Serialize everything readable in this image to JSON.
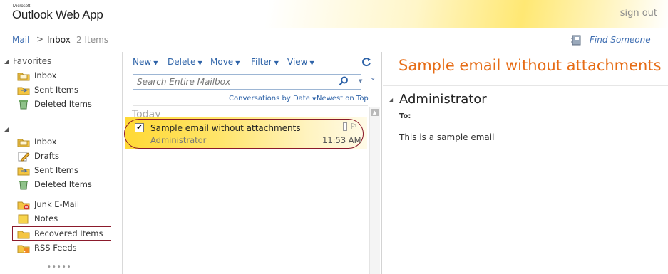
{
  "header": {
    "brand_small": "Microsoft",
    "brand_main": "Outlook Web App",
    "signout": "sign out"
  },
  "breadcrumb": {
    "mail": "Mail",
    "separator": ">",
    "inbox": "Inbox",
    "count": "2 Items",
    "find_someone": "Find Someone"
  },
  "nav": {
    "favorites_title": "Favorites",
    "favorites": [
      {
        "label": "Inbox",
        "icon": "inbox-folder-icon"
      },
      {
        "label": "Sent Items",
        "icon": "sent-items-icon"
      },
      {
        "label": "Deleted Items",
        "icon": "deleted-items-icon"
      }
    ],
    "folders": [
      {
        "label": "Inbox",
        "icon": "inbox-folder-icon"
      },
      {
        "label": "Drafts",
        "icon": "drafts-icon"
      },
      {
        "label": "Sent Items",
        "icon": "sent-items-icon"
      },
      {
        "label": "Deleted Items",
        "icon": "deleted-items-icon"
      },
      {
        "label": "Junk E-Mail",
        "icon": "junk-mail-icon"
      },
      {
        "label": "Notes",
        "icon": "notes-icon"
      },
      {
        "label": "Recovered Items",
        "icon": "folder-icon"
      },
      {
        "label": "RSS Feeds",
        "icon": "rss-feeds-icon"
      }
    ],
    "more_dots": "•••••"
  },
  "toolbar": {
    "new": "New",
    "delete": "Delete",
    "move": "Move",
    "filter": "Filter",
    "view": "View"
  },
  "search": {
    "placeholder": "Search Entire Mailbox"
  },
  "sort": {
    "conversations": "Conversations by Date",
    "order": "Newest on Top"
  },
  "list": {
    "group": "Today",
    "messages": [
      {
        "subject": "Sample email without attachments",
        "sender": "Administrator",
        "time": "11:53 AM"
      }
    ]
  },
  "reading": {
    "subject": "Sample email without attachments",
    "from": "Administrator",
    "to_label": "To:",
    "body": "This is a sample email"
  },
  "colors": {
    "accent_blue": "#2e63a8",
    "subject_orange": "#e66c16",
    "selection_yellow": "#ffd935",
    "highlight_red": "#8b1a2b"
  }
}
